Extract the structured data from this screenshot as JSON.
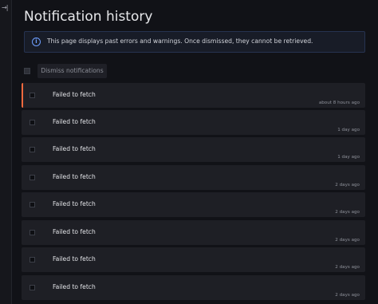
{
  "rail": {
    "toggle_label": "→|"
  },
  "page": {
    "title": "Notification history"
  },
  "alert": {
    "icon": "info-icon",
    "icon_glyph": "i",
    "text": "This page displays past errors and warnings. Once dismissed, they cannot be retrieved."
  },
  "toolbar": {
    "dismiss_label": "Dismiss notifications"
  },
  "notifications": [
    {
      "text": "Failed to fetch",
      "time": "about 8 hours ago"
    },
    {
      "text": "Failed to fetch",
      "time": "1 day ago"
    },
    {
      "text": "Failed to fetch",
      "time": "1 day ago"
    },
    {
      "text": "Failed to fetch",
      "time": "2 days ago"
    },
    {
      "text": "Failed to fetch",
      "time": "2 days ago"
    },
    {
      "text": "Failed to fetch",
      "time": "2 days ago"
    },
    {
      "text": "Failed to fetch",
      "time": "2 days ago"
    },
    {
      "text": "Failed to fetch",
      "time": "2 days ago"
    }
  ],
  "colors": {
    "background": "#111217",
    "row_background": "#1e1f25",
    "unread_accent": "#f0693e",
    "info_accent": "#6e9fff"
  }
}
